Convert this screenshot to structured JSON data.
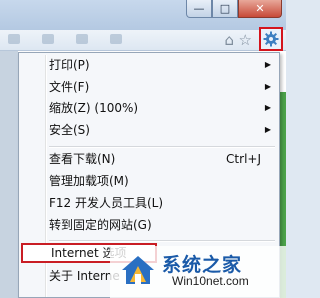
{
  "window": {
    "minimize_glyph": "—",
    "maximize_glyph": "□",
    "close_glyph": "✕"
  },
  "toolbar": {
    "home_icon": "home-icon",
    "favorites_icon": "star-icon",
    "tools_icon": "gear-icon",
    "tools_highlight_color": "#d4141c"
  },
  "menu": {
    "items": [
      {
        "label": "打印(P)",
        "submenu": true
      },
      {
        "label": "文件(F)",
        "submenu": true
      },
      {
        "label": "缩放(Z) (100%)",
        "submenu": true
      },
      {
        "label": "安全(S)",
        "submenu": true
      },
      {
        "label": "查看下载(N)",
        "shortcut": "Ctrl+J"
      },
      {
        "label": "管理加载项(M)"
      },
      {
        "label": "F12 开发人员工具(L)"
      },
      {
        "label": "转到固定的网站(G)"
      },
      {
        "label": "Internet 选项"
      },
      {
        "label": "关于 Interne"
      }
    ],
    "highlight_color": "#c91d24"
  },
  "watermark": {
    "title": "系统之家",
    "url": "Win10net.com"
  },
  "accent_green": "#4ca34a"
}
